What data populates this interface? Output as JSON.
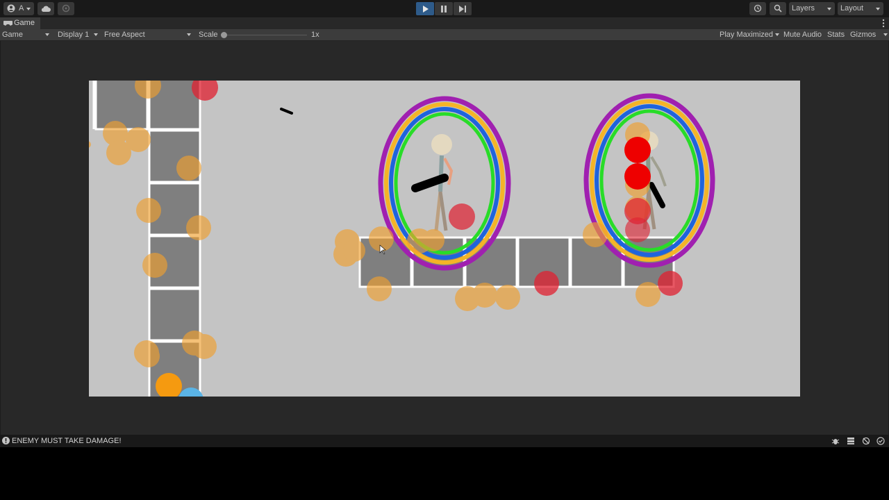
{
  "toolbar": {
    "account_label": "A",
    "layers_label": "Layers",
    "layout_label": "Layout",
    "icons": [
      "account-icon",
      "cloud-icon",
      "collab-icon",
      "play-icon",
      "pause-icon",
      "step-icon",
      "history-icon",
      "search-icon"
    ],
    "play_active_color": "#2e5b8a"
  },
  "tab": {
    "title": "Game"
  },
  "options": {
    "mode": "Game",
    "display": "Display 1",
    "aspect": "Free Aspect",
    "scale_label": "Scale",
    "scale_value": "1x",
    "play_mode": "Play Maximized",
    "mute": "Mute Audio",
    "stats": "Stats",
    "gizmos": "Gizmos"
  },
  "status": {
    "message": "ENEMY MUST TAKE DAMAGE!"
  },
  "colors": {
    "background": "#c4c4c4",
    "tile": "#7f7f7f",
    "ring_purple": "#a020b0",
    "ring_yellow": "#f4b428",
    "ring_blue": "#1e64dc",
    "ring_green": "#28dc28",
    "particle_orange": "#f0a030",
    "particle_red": "#e02030"
  }
}
